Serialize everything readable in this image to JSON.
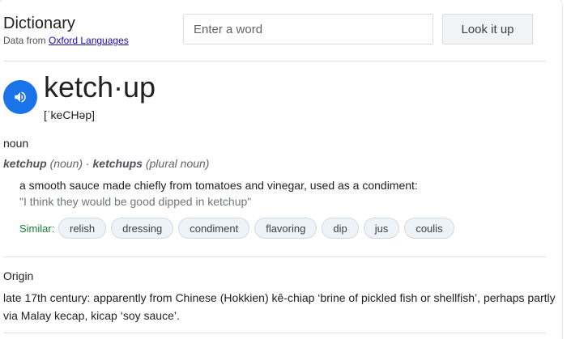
{
  "header": {
    "title": "Dictionary",
    "source_prefix": "Data from ",
    "source_link": "Oxford Languages"
  },
  "search": {
    "placeholder": "Enter a word",
    "value": "",
    "button_label": "Look it up"
  },
  "entry": {
    "speaker_icon": "speaker-icon",
    "word": "ketch·up",
    "phonetic": "[ˈkeCHəp]",
    "part_of_speech": "noun",
    "forms": {
      "singular": "ketchup",
      "singular_pos": " (noun) · ",
      "plural": "ketchups",
      "plural_pos": " (plural noun)"
    },
    "definition": "a smooth sauce made chiefly from tomatoes and vinegar, used as a condiment:",
    "example": "\"I think they would be good dipped in ketchup\"",
    "similar_label": "Similar:",
    "similar": [
      "relish",
      "dressing",
      "condiment",
      "flavoring",
      "dip",
      "jus",
      "coulis"
    ]
  },
  "origin": {
    "title": "Origin",
    "text": "late 17th century: apparently from Chinese (Hokkien) kê-chiap ‘brine of pickled fish or shellfish’, perhaps partly via Malay kecap, kicap ‘soy sauce’."
  },
  "colors": {
    "accent": "#1a73e8",
    "link": "#1a0dab",
    "similar_label": "#188038",
    "chip_bg": "#eef3f8"
  }
}
